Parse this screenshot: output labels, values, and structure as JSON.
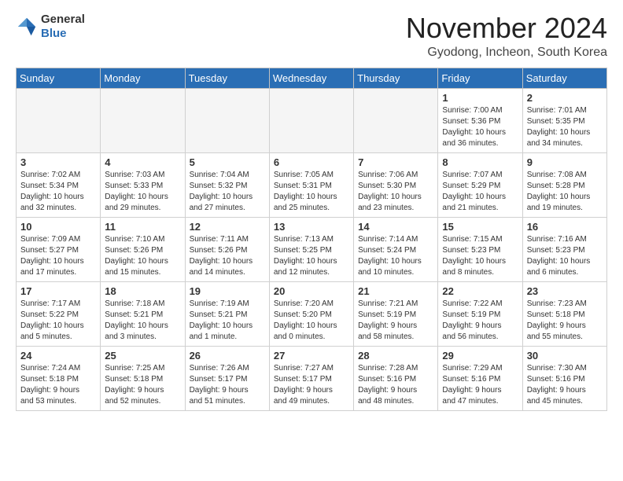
{
  "header": {
    "logo_line1": "General",
    "logo_line2": "Blue",
    "month_title": "November 2024",
    "location": "Gyodong, Incheon, South Korea"
  },
  "weekdays": [
    "Sunday",
    "Monday",
    "Tuesday",
    "Wednesday",
    "Thursday",
    "Friday",
    "Saturday"
  ],
  "weeks": [
    [
      {
        "day": "",
        "info": ""
      },
      {
        "day": "",
        "info": ""
      },
      {
        "day": "",
        "info": ""
      },
      {
        "day": "",
        "info": ""
      },
      {
        "day": "",
        "info": ""
      },
      {
        "day": "1",
        "info": "Sunrise: 7:00 AM\nSunset: 5:36 PM\nDaylight: 10 hours\nand 36 minutes."
      },
      {
        "day": "2",
        "info": "Sunrise: 7:01 AM\nSunset: 5:35 PM\nDaylight: 10 hours\nand 34 minutes."
      }
    ],
    [
      {
        "day": "3",
        "info": "Sunrise: 7:02 AM\nSunset: 5:34 PM\nDaylight: 10 hours\nand 32 minutes."
      },
      {
        "day": "4",
        "info": "Sunrise: 7:03 AM\nSunset: 5:33 PM\nDaylight: 10 hours\nand 29 minutes."
      },
      {
        "day": "5",
        "info": "Sunrise: 7:04 AM\nSunset: 5:32 PM\nDaylight: 10 hours\nand 27 minutes."
      },
      {
        "day": "6",
        "info": "Sunrise: 7:05 AM\nSunset: 5:31 PM\nDaylight: 10 hours\nand 25 minutes."
      },
      {
        "day": "7",
        "info": "Sunrise: 7:06 AM\nSunset: 5:30 PM\nDaylight: 10 hours\nand 23 minutes."
      },
      {
        "day": "8",
        "info": "Sunrise: 7:07 AM\nSunset: 5:29 PM\nDaylight: 10 hours\nand 21 minutes."
      },
      {
        "day": "9",
        "info": "Sunrise: 7:08 AM\nSunset: 5:28 PM\nDaylight: 10 hours\nand 19 minutes."
      }
    ],
    [
      {
        "day": "10",
        "info": "Sunrise: 7:09 AM\nSunset: 5:27 PM\nDaylight: 10 hours\nand 17 minutes."
      },
      {
        "day": "11",
        "info": "Sunrise: 7:10 AM\nSunset: 5:26 PM\nDaylight: 10 hours\nand 15 minutes."
      },
      {
        "day": "12",
        "info": "Sunrise: 7:11 AM\nSunset: 5:26 PM\nDaylight: 10 hours\nand 14 minutes."
      },
      {
        "day": "13",
        "info": "Sunrise: 7:13 AM\nSunset: 5:25 PM\nDaylight: 10 hours\nand 12 minutes."
      },
      {
        "day": "14",
        "info": "Sunrise: 7:14 AM\nSunset: 5:24 PM\nDaylight: 10 hours\nand 10 minutes."
      },
      {
        "day": "15",
        "info": "Sunrise: 7:15 AM\nSunset: 5:23 PM\nDaylight: 10 hours\nand 8 minutes."
      },
      {
        "day": "16",
        "info": "Sunrise: 7:16 AM\nSunset: 5:23 PM\nDaylight: 10 hours\nand 6 minutes."
      }
    ],
    [
      {
        "day": "17",
        "info": "Sunrise: 7:17 AM\nSunset: 5:22 PM\nDaylight: 10 hours\nand 5 minutes."
      },
      {
        "day": "18",
        "info": "Sunrise: 7:18 AM\nSunset: 5:21 PM\nDaylight: 10 hours\nand 3 minutes."
      },
      {
        "day": "19",
        "info": "Sunrise: 7:19 AM\nSunset: 5:21 PM\nDaylight: 10 hours\nand 1 minute."
      },
      {
        "day": "20",
        "info": "Sunrise: 7:20 AM\nSunset: 5:20 PM\nDaylight: 10 hours\nand 0 minutes."
      },
      {
        "day": "21",
        "info": "Sunrise: 7:21 AM\nSunset: 5:19 PM\nDaylight: 9 hours\nand 58 minutes."
      },
      {
        "day": "22",
        "info": "Sunrise: 7:22 AM\nSunset: 5:19 PM\nDaylight: 9 hours\nand 56 minutes."
      },
      {
        "day": "23",
        "info": "Sunrise: 7:23 AM\nSunset: 5:18 PM\nDaylight: 9 hours\nand 55 minutes."
      }
    ],
    [
      {
        "day": "24",
        "info": "Sunrise: 7:24 AM\nSunset: 5:18 PM\nDaylight: 9 hours\nand 53 minutes."
      },
      {
        "day": "25",
        "info": "Sunrise: 7:25 AM\nSunset: 5:18 PM\nDaylight: 9 hours\nand 52 minutes."
      },
      {
        "day": "26",
        "info": "Sunrise: 7:26 AM\nSunset: 5:17 PM\nDaylight: 9 hours\nand 51 minutes."
      },
      {
        "day": "27",
        "info": "Sunrise: 7:27 AM\nSunset: 5:17 PM\nDaylight: 9 hours\nand 49 minutes."
      },
      {
        "day": "28",
        "info": "Sunrise: 7:28 AM\nSunset: 5:16 PM\nDaylight: 9 hours\nand 48 minutes."
      },
      {
        "day": "29",
        "info": "Sunrise: 7:29 AM\nSunset: 5:16 PM\nDaylight: 9 hours\nand 47 minutes."
      },
      {
        "day": "30",
        "info": "Sunrise: 7:30 AM\nSunset: 5:16 PM\nDaylight: 9 hours\nand 45 minutes."
      }
    ]
  ]
}
